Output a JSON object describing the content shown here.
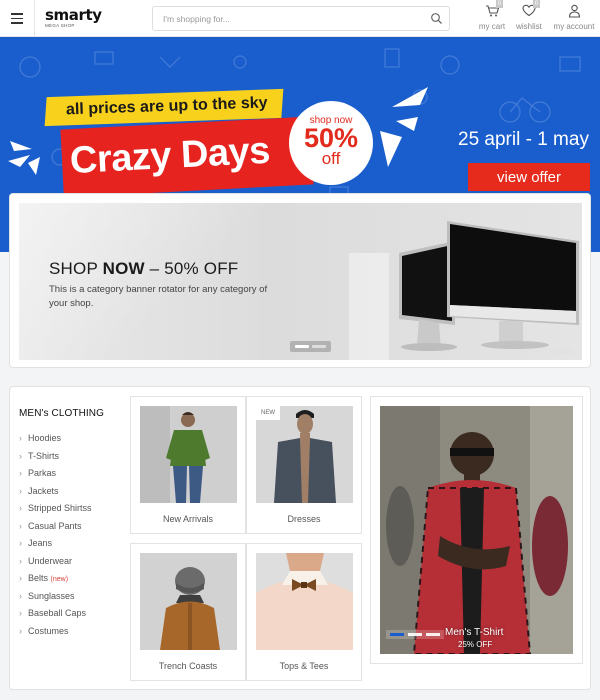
{
  "header": {
    "logo": {
      "brand": "smarty",
      "tagline": "MEGA SHOP"
    },
    "search": {
      "placeholder": "I'm shopping for...",
      "icon": "search-icon"
    },
    "cart": {
      "label": "my cart",
      "count": "0",
      "icon": "cart-icon"
    },
    "wishlist": {
      "label": "wishlist",
      "count": "0",
      "icon": "heart-icon"
    },
    "account": {
      "label": "my account",
      "icon": "user-icon"
    }
  },
  "hero": {
    "tagline": "all prices are up to the sky",
    "title": "Crazy Days",
    "discount": {
      "line1": "shop now",
      "percent": "50%",
      "line3": "off"
    },
    "dates": "25 april - 1 may",
    "cta": "view offer",
    "colors": {
      "background": "#1a5ece",
      "red": "#e6231e",
      "yellow": "#f7d11c"
    }
  },
  "category_banner": {
    "heading_pre": "SHOP ",
    "heading_bold": "NOW",
    "heading_post": " – 50% OFF",
    "description": "This is a category banner rotator for any category of your shop.",
    "slides": 2,
    "active_slide": 1
  },
  "sidebar": {
    "title": "MEN's CLOTHING",
    "items": [
      {
        "label": "Hoodies",
        "badge": ""
      },
      {
        "label": "T-Shirts",
        "badge": ""
      },
      {
        "label": "Parkas",
        "badge": ""
      },
      {
        "label": "Jackets",
        "badge": ""
      },
      {
        "label": "Stripped Shirtss",
        "badge": ""
      },
      {
        "label": "Casual Pants",
        "badge": ""
      },
      {
        "label": "Jeans",
        "badge": ""
      },
      {
        "label": "Underwear",
        "badge": ""
      },
      {
        "label": "Belts",
        "badge": "(new)"
      },
      {
        "label": "Sunglasses",
        "badge": ""
      },
      {
        "label": "Baseball Caps",
        "badge": ""
      },
      {
        "label": "Costumes",
        "badge": ""
      }
    ]
  },
  "tiles": [
    {
      "label": "New Arrivals",
      "badge": ""
    },
    {
      "label": "Dresses",
      "badge": "NEW"
    },
    {
      "label": "Trench Coasts",
      "badge": ""
    },
    {
      "label": "Tops & Tees",
      "badge": ""
    }
  ],
  "feature": {
    "title": "Men's T-Shirt",
    "subtitle": "25% OFF",
    "slides": 3,
    "active_slide": 1
  }
}
